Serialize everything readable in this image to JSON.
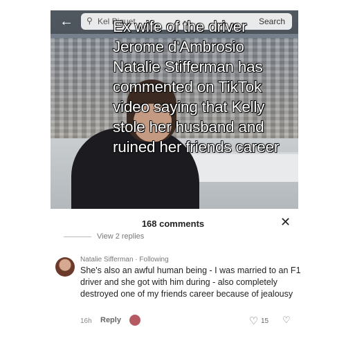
{
  "video": {
    "back_glyph": "←",
    "search": {
      "value": "Kel Piquet",
      "button": "Search"
    },
    "caption_lines": [
      "Ex wife of the driver",
      "Jerome d'Ambrosio",
      "Natalie Stifferman has",
      "commented on TikTok",
      "video saying that Kelly",
      "stole her husband and",
      "ruined her friends career"
    ]
  },
  "comments_panel": {
    "count_label": "168 comments",
    "close_glyph": "✕",
    "view_replies": "View 2 replies",
    "comment": {
      "author": "Natalie Sifferman",
      "separator": " · ",
      "status": "Following",
      "text": "She's also an awful human being - I was married to an F1 driver and she got with him during - also completely destroyed one of my friends career because of jealousy",
      "time": "16h",
      "reply_label": "Reply",
      "likes": "15"
    }
  }
}
